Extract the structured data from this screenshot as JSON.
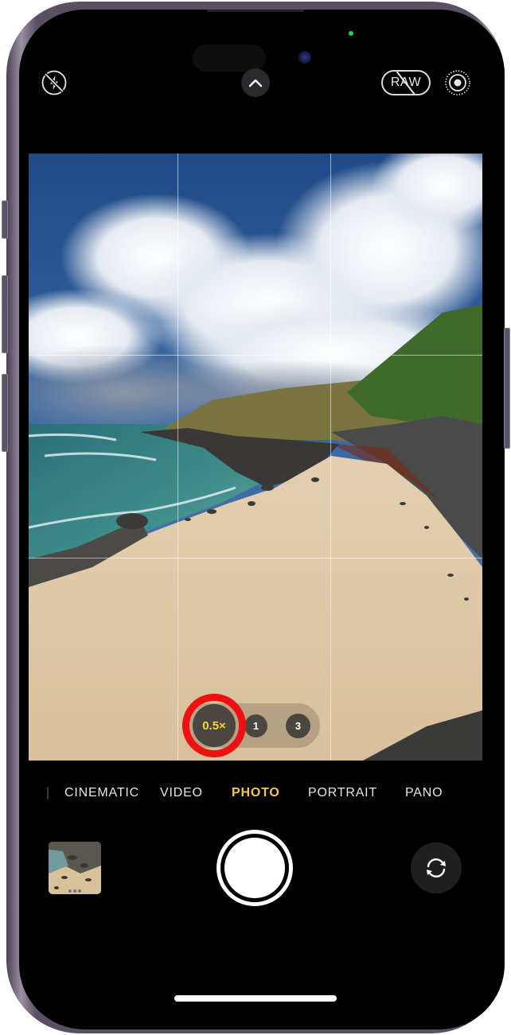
{
  "app": "Camera",
  "top_bar": {
    "flash": {
      "icon": "flash-off-icon",
      "state": "off"
    },
    "controls_toggle": {
      "icon": "chevron-up-icon"
    },
    "raw": {
      "label": "RAW",
      "state": "off"
    },
    "live_photo": {
      "icon": "live-photo-icon",
      "state": "on"
    }
  },
  "viewfinder": {
    "grid": "3x3",
    "scene": "beach with cliffs, ocean and clouds"
  },
  "zoom": {
    "options": [
      {
        "label": "0.5×",
        "selected": true
      },
      {
        "label": "1",
        "selected": false
      },
      {
        "label": "3",
        "selected": false
      }
    ],
    "highlight_color": "#ee1111",
    "selected_text_color": "#f5d33a"
  },
  "modes": {
    "items": [
      {
        "label": "CINEMATIC",
        "active": false
      },
      {
        "label": "VIDEO",
        "active": false
      },
      {
        "label": "PHOTO",
        "active": true
      },
      {
        "label": "PORTRAIT",
        "active": false
      },
      {
        "label": "PANO",
        "active": false
      }
    ],
    "active_color": "#f2c94c"
  },
  "bottom_bar": {
    "thumbnail": {
      "icon": "last-photo-thumbnail"
    },
    "shutter": {
      "icon": "shutter-button"
    },
    "flip": {
      "icon": "camera-flip-icon"
    }
  }
}
